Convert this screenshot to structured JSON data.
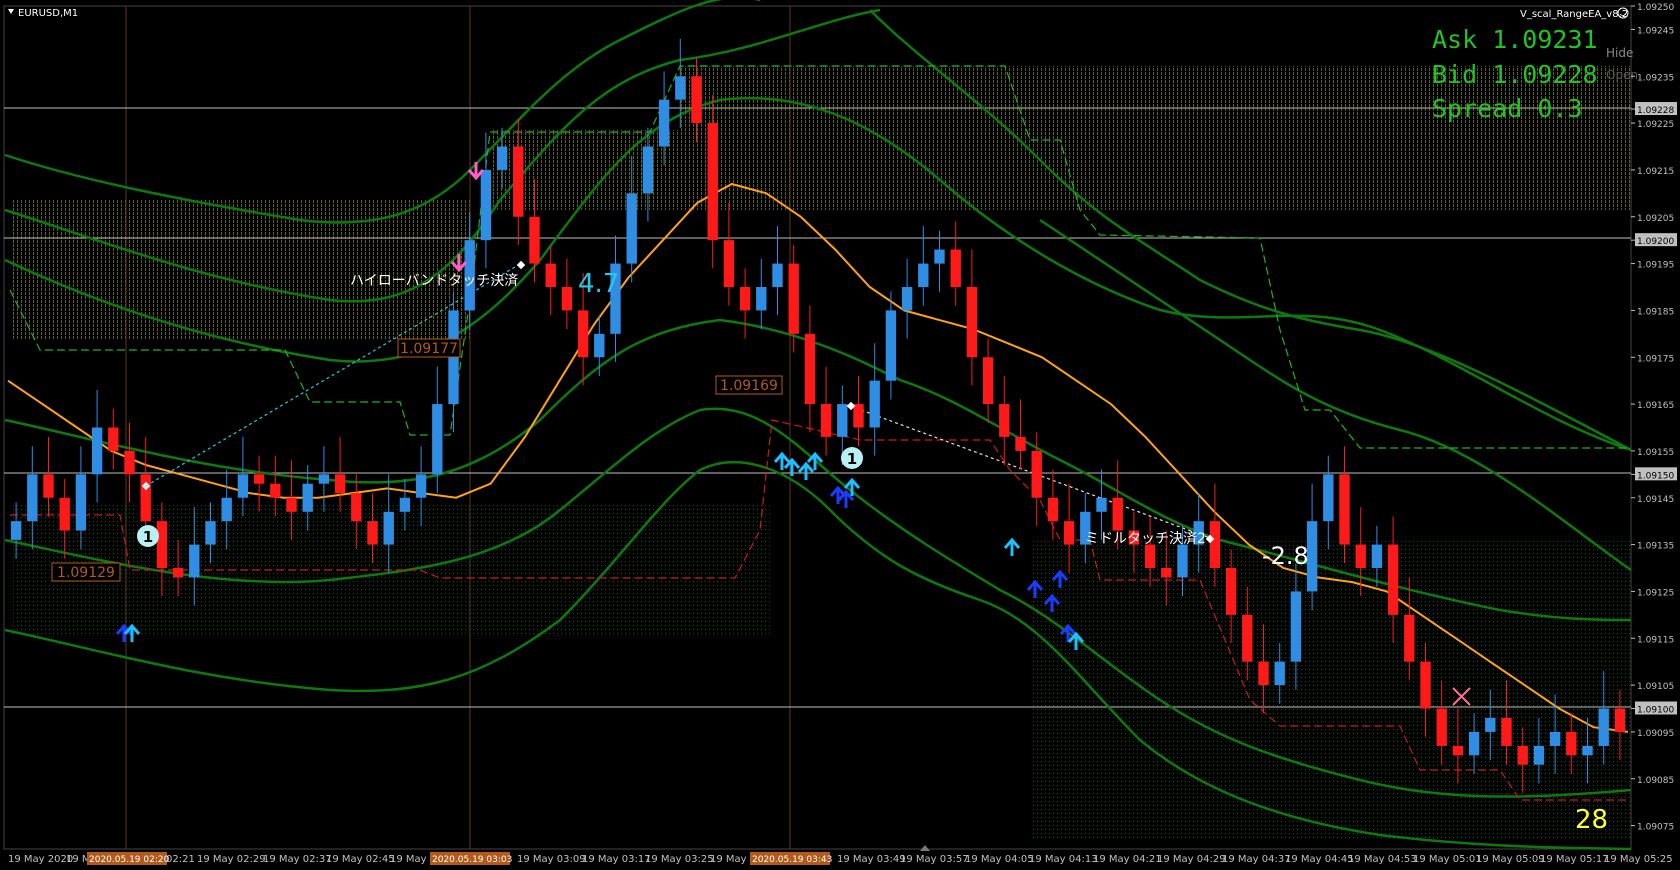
{
  "window": {
    "symbol_title": "EURUSD,M1",
    "ea_name": "V_scal_RangeEA_v8.2",
    "hide_label": "Hide",
    "open_label": "Open"
  },
  "quotes": {
    "ask": "Ask 1.09231",
    "bid": "Bid 1.09228",
    "spread": "Spread 0.3"
  },
  "price_axis": {
    "labels": [
      "1.09250",
      "1.09245",
      "1.09235",
      "1.09228",
      "1.09225",
      "1.09215",
      "1.09205",
      "1.09200",
      "1.09195",
      "1.09185",
      "1.09175",
      "1.09165",
      "1.09155",
      "1.09150",
      "1.09145",
      "1.09135",
      "1.09125",
      "1.09115",
      "1.09105",
      "1.09100",
      "1.09095",
      "1.09085",
      "1.09075"
    ],
    "highlighted": [
      "1.09228",
      "1.09200",
      "1.09150",
      "1.09100"
    ]
  },
  "time_axis": {
    "labels": [
      "19 May 2020",
      "19 M",
      "02:21",
      "19 May 02:29",
      "19 May 02:37",
      "19 May 02:45",
      "19 May 0",
      "19 May 03:09",
      "19 May 03:17",
      "19 May 03:25",
      "19 May 0",
      "19 May 03:49",
      "19 May 03:57",
      "19 May 04:05",
      "19 May 04:13",
      "19 May 04:21",
      "19 May 04:29",
      "19 May 04:37",
      "19 May 04:45",
      "19 May 04:53",
      "19 May 05:01",
      "19 May 05:09",
      "19 May 05:17",
      "19 May 05:25"
    ],
    "markers": [
      "2020.05.19 02:20",
      "2020.05.19 03:03",
      "2020.05.19 03:43"
    ]
  },
  "annotations": {
    "label_hilow": "ハイローバンドタッチ決済",
    "label_middle": "ミドルタッチ決済2",
    "profit_1": "4.7",
    "profit_2": "-2.8",
    "counter": "28",
    "price_box_1": "1.09129",
    "price_box_2": "1.09177",
    "price_box_3": "1.09169",
    "entry_mark": "1"
  },
  "colors": {
    "background": "#000000",
    "bull_candle": "#2f8de4",
    "bear_candle": "#ff1a1a",
    "band": "#0e7a0e",
    "ma": "#ffa21a",
    "ask_text": "#22c322",
    "arrow_buy": "#1ebfff",
    "arrow_sell": "#ff5ec8",
    "box_border": "#b35a1a",
    "counter_text": "#ffff33"
  },
  "chart_data": {
    "type": "line",
    "symbol": "EURUSD",
    "timeframe": "M1",
    "ylim": [
      1.0907,
      1.0925
    ],
    "horizontal_levels": [
      1.09228,
      1.092,
      1.0915,
      1.091
    ],
    "series": [
      {
        "values": [
          1.0914,
          1.0915,
          1.09145,
          1.09138,
          1.0915,
          1.0916,
          1.09155,
          1.0915,
          1.0914,
          1.0913,
          1.09128,
          1.09135,
          1.0914,
          1.09145,
          1.0915,
          1.09148,
          1.09145,
          1.09142,
          1.09148,
          1.0915,
          1.09146,
          1.0914,
          1.09135,
          1.09142,
          1.09145,
          1.0915,
          1.09165,
          1.09185,
          1.092,
          1.09215,
          1.0922,
          1.09205,
          1.09195,
          1.0919,
          1.09185,
          1.09175,
          1.0918,
          1.09195,
          1.0921,
          1.0922,
          1.0923,
          1.09235,
          1.09225,
          1.092,
          1.0919,
          1.09185,
          1.0919,
          1.09195,
          1.0918,
          1.09165,
          1.09158,
          1.09165,
          1.0916,
          1.0917,
          1.09185,
          1.0919,
          1.09195,
          1.09198,
          1.0919,
          1.09175,
          1.09165,
          1.09158,
          1.09155,
          1.09145,
          1.0914,
          1.09135,
          1.09142,
          1.09145,
          1.09138,
          1.09135,
          1.0913,
          1.09128,
          1.09135,
          1.0914,
          1.0913,
          1.0912,
          1.0911,
          1.09105,
          1.0911,
          1.09125,
          1.0914,
          1.0915,
          1.09135,
          1.0913,
          1.09135,
          1.0912,
          1.0911,
          1.091,
          1.09092,
          1.0909,
          1.09095,
          1.09098,
          1.09092,
          1.09088,
          1.09092,
          1.09095,
          1.0909,
          1.09092,
          1.091,
          1.09095
        ]
      },
      {
        "values": [
          1.0917,
          1.09165,
          1.0916,
          1.09155,
          1.09152,
          1.0915,
          1.09148,
          1.09146,
          1.09145,
          1.09145,
          1.09146,
          1.09147,
          1.09146,
          1.09145,
          1.09148,
          1.09158,
          1.0917,
          1.09182,
          1.09192,
          1.092,
          1.09208,
          1.09212,
          1.0921,
          1.09205,
          1.09198,
          1.0919,
          1.09185,
          1.09183,
          1.09181,
          1.09178,
          1.09175,
          1.0917,
          1.09165,
          1.09158,
          1.0915,
          1.09142,
          1.09135,
          1.0913,
          1.09128,
          1.09127,
          1.09125,
          1.0912,
          1.09115,
          1.0911,
          1.09105,
          1.091,
          1.09096,
          1.09095
        ]
      }
    ]
  }
}
